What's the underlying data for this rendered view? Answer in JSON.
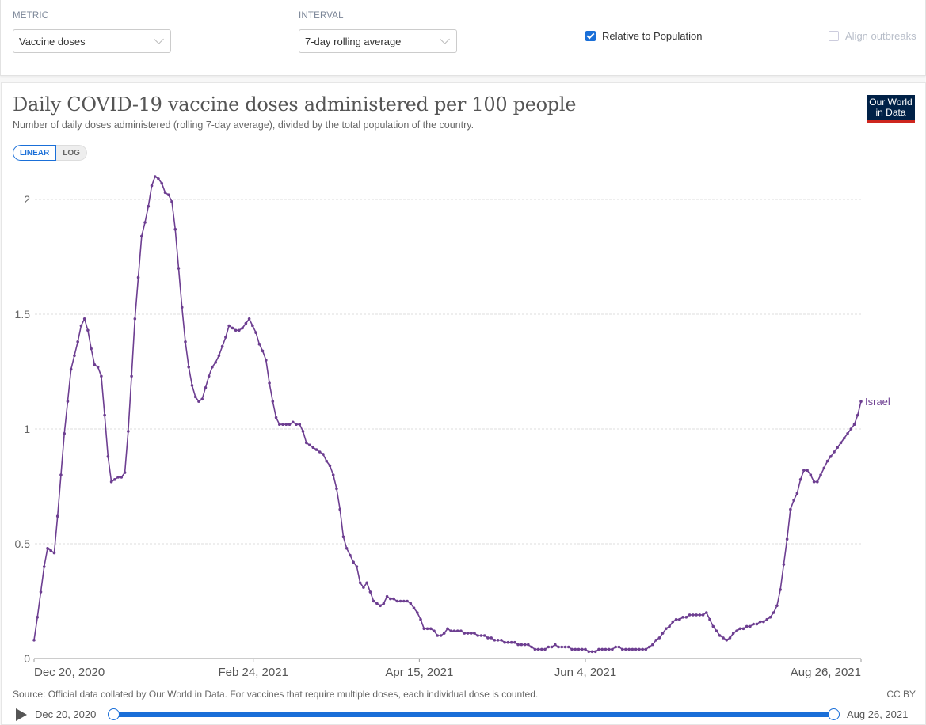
{
  "controls": {
    "metric_label": "METRIC",
    "metric_value": "Vaccine doses",
    "interval_label": "INTERVAL",
    "interval_value": "7-day rolling average",
    "relative_to_population": {
      "label": "Relative to Population",
      "checked": true
    },
    "align_outbreaks": {
      "label": "Align outbreaks",
      "checked": false,
      "disabled": true
    }
  },
  "header": {
    "title": "Daily COVID-19 vaccine doses administered per 100 people",
    "subtitle": "Number of daily doses administered (rolling 7-day average), divided by the total population of the country.",
    "logo_line1": "Our World",
    "logo_line2": "in Data"
  },
  "scale_toggle": {
    "linear": "LINEAR",
    "log": "LOG",
    "active": "LINEAR"
  },
  "footer": {
    "source": "Source: Official data collated by Our World in Data. For vaccines that require multiple doses, each individual dose is counted.",
    "license": "CC BY"
  },
  "timeline": {
    "start_label": "Dec 20, 2020",
    "end_label": "Aug 26, 2021",
    "start_fraction": 0,
    "end_fraction": 1
  },
  "colors": {
    "series": "#6d3e91",
    "accent": "#1a6fd8",
    "grid": "#dddddd"
  },
  "chart_data": {
    "type": "line",
    "title": "Daily COVID-19 vaccine doses administered per 100 people",
    "xlabel": "",
    "ylabel": "",
    "x_start": "Dec 20, 2020",
    "x_end": "Aug 26, 2021",
    "x_interval": "1 day",
    "ylim": [
      0,
      2.1
    ],
    "y_ticks": [
      0,
      0.5,
      1,
      1.5,
      2
    ],
    "y_tick_labels": [
      "0",
      "0.5",
      "1",
      "1.5",
      "2"
    ],
    "x_ticks": [
      "Dec 20, 2020",
      "Feb 24, 2021",
      "Apr 15, 2021",
      "Jun 4, 2021",
      "Aug 26, 2021"
    ],
    "x_tick_day_offsets": [
      0,
      66,
      116,
      166,
      249
    ],
    "grid": "horizontal dashed",
    "legend": "end-of-line label",
    "series": [
      {
        "name": "Israel",
        "values": [
          0.08,
          0.18,
          0.29,
          0.4,
          0.48,
          0.47,
          0.46,
          0.62,
          0.8,
          0.98,
          1.12,
          1.26,
          1.32,
          1.38,
          1.45,
          1.48,
          1.43,
          1.35,
          1.28,
          1.27,
          1.23,
          1.06,
          0.88,
          0.77,
          0.78,
          0.79,
          0.79,
          0.81,
          0.99,
          1.23,
          1.48,
          1.66,
          1.84,
          1.9,
          1.97,
          2.06,
          2.1,
          2.09,
          2.07,
          2.03,
          2.02,
          1.99,
          1.87,
          1.7,
          1.53,
          1.38,
          1.27,
          1.19,
          1.14,
          1.12,
          1.13,
          1.18,
          1.23,
          1.27,
          1.29,
          1.32,
          1.36,
          1.4,
          1.45,
          1.44,
          1.43,
          1.43,
          1.44,
          1.46,
          1.48,
          1.45,
          1.42,
          1.37,
          1.34,
          1.3,
          1.2,
          1.12,
          1.05,
          1.02,
          1.02,
          1.02,
          1.02,
          1.03,
          1.02,
          1.02,
          0.99,
          0.94,
          0.93,
          0.92,
          0.91,
          0.9,
          0.89,
          0.86,
          0.84,
          0.8,
          0.74,
          0.65,
          0.53,
          0.48,
          0.45,
          0.42,
          0.4,
          0.33,
          0.31,
          0.33,
          0.29,
          0.25,
          0.24,
          0.23,
          0.24,
          0.27,
          0.26,
          0.26,
          0.25,
          0.25,
          0.25,
          0.25,
          0.24,
          0.22,
          0.2,
          0.17,
          0.13,
          0.13,
          0.13,
          0.12,
          0.1,
          0.1,
          0.11,
          0.13,
          0.12,
          0.12,
          0.12,
          0.12,
          0.11,
          0.11,
          0.11,
          0.11,
          0.1,
          0.1,
          0.1,
          0.09,
          0.09,
          0.08,
          0.08,
          0.08,
          0.07,
          0.07,
          0.07,
          0.07,
          0.06,
          0.06,
          0.06,
          0.06,
          0.05,
          0.04,
          0.04,
          0.04,
          0.04,
          0.05,
          0.05,
          0.06,
          0.05,
          0.05,
          0.05,
          0.05,
          0.04,
          0.04,
          0.04,
          0.04,
          0.04,
          0.03,
          0.03,
          0.03,
          0.04,
          0.04,
          0.04,
          0.04,
          0.04,
          0.05,
          0.05,
          0.04,
          0.04,
          0.04,
          0.04,
          0.04,
          0.04,
          0.04,
          0.04,
          0.05,
          0.06,
          0.08,
          0.09,
          0.11,
          0.13,
          0.14,
          0.16,
          0.17,
          0.17,
          0.18,
          0.18,
          0.19,
          0.19,
          0.19,
          0.19,
          0.19,
          0.2,
          0.17,
          0.14,
          0.12,
          0.1,
          0.09,
          0.08,
          0.09,
          0.11,
          0.12,
          0.13,
          0.13,
          0.14,
          0.14,
          0.15,
          0.15,
          0.16,
          0.16,
          0.17,
          0.18,
          0.2,
          0.23,
          0.3,
          0.41,
          0.52,
          0.65,
          0.69,
          0.72,
          0.78,
          0.82,
          0.82,
          0.8,
          0.77,
          0.77,
          0.8,
          0.83,
          0.86,
          0.88,
          0.9,
          0.92,
          0.94,
          0.96,
          0.98,
          1.0,
          1.02,
          1.06,
          1.12
        ]
      }
    ]
  }
}
